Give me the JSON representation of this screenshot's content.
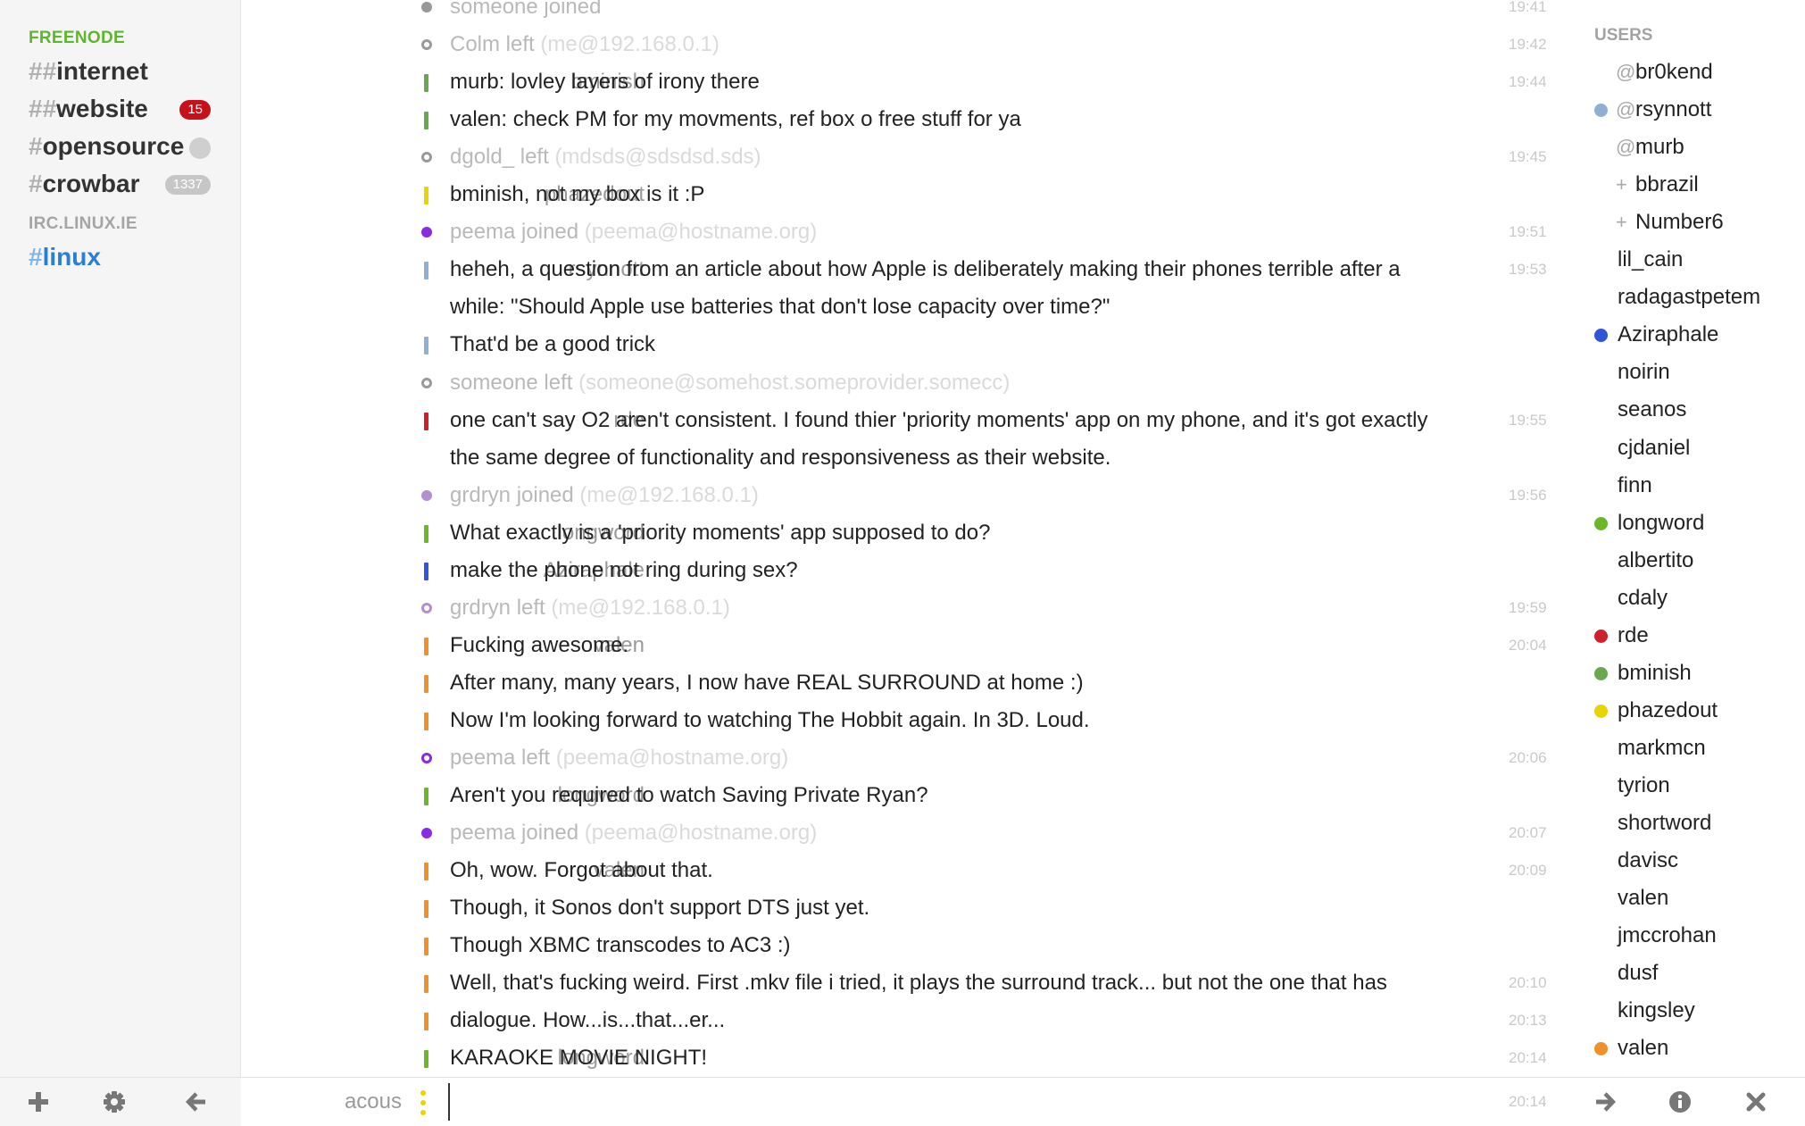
{
  "sidebar": {
    "networks": [
      {
        "name": "FREENODE",
        "color": "#5cb82a",
        "channels": [
          {
            "prefix": "##",
            "name": "internet",
            "badge": "",
            "badge_type": "none",
            "active": false
          },
          {
            "prefix": "##",
            "name": "website",
            "badge": "15",
            "badge_type": "red",
            "active": false
          },
          {
            "prefix": "#",
            "name": "opensource",
            "badge": "",
            "badge_type": "dot",
            "active": false
          },
          {
            "prefix": "#",
            "name": "crowbar",
            "badge": "1337",
            "badge_type": "gray",
            "active": false
          }
        ]
      },
      {
        "name": "IRC.LINUX.IE",
        "color": "#a5a5a5",
        "channels": [
          {
            "prefix": "#",
            "name": "linux",
            "badge": "",
            "badge_type": "none",
            "active": true
          }
        ]
      }
    ]
  },
  "messages": [
    {
      "type": "event",
      "text": "someone joined",
      "host": "",
      "time": "19:41",
      "color": "#999999",
      "event": "join"
    },
    {
      "type": "event",
      "text": "Colm left",
      "host": "(me@192.168.0.1)",
      "time": "19:42",
      "color": "#9a9a9a",
      "event": "leave"
    },
    {
      "type": "msg",
      "nick": "bminish",
      "text": "murb: lovley layers of irony there",
      "time": "19:44",
      "color": "#6aa84f"
    },
    {
      "type": "msg",
      "nick": "",
      "text": "valen: check PM for my movments, ref box o free stuff for ya",
      "time": "",
      "color": "#6aa84f"
    },
    {
      "type": "event",
      "text": "dgold_ left",
      "host": "(mdsds@sdsdsd.sds)",
      "time": "19:45",
      "color": "#9a9a9a",
      "event": "leave"
    },
    {
      "type": "msg",
      "nick": "phazedout",
      "text": "bminish, not my box is it :P",
      "time": "",
      "color": "#e8d400"
    },
    {
      "type": "event",
      "text": "peema joined",
      "host": "(peema@hostname.org)",
      "time": "19:51",
      "color": "#8a2be2",
      "event": "join"
    },
    {
      "type": "msg",
      "nick": "rsynnott",
      "text": "heheh, a question from an article about how Apple is deliberately making their phones terrible after a",
      "time": "19:53",
      "color": "#8fb0d0"
    },
    {
      "type": "msg",
      "nick": "",
      "text": "while: \"Should Apple use batteries that don't lose capacity over time?\"",
      "time": "",
      "color": "",
      "nomark": true
    },
    {
      "type": "msg",
      "nick": "",
      "text": "That'd be a good trick",
      "time": "",
      "color": "#8fb0d0"
    },
    {
      "type": "event",
      "text": "someone left",
      "host": "(someone@somehost.someprovider.somecc)",
      "time": "",
      "color": "#9a9a9a",
      "event": "leave"
    },
    {
      "type": "msg",
      "nick": "rde",
      "text": "one can't say O2 aren't consistent. I found thier 'priority moments' app on my phone, and it's got exactly",
      "time": "19:55",
      "color": "#d0212b"
    },
    {
      "type": "msg",
      "nick": "",
      "text": "the same degree of functionality and responsiveness as their website.",
      "time": "",
      "color": "",
      "nomark": true
    },
    {
      "type": "event",
      "text": "grdryn joined",
      "host": "(me@192.168.0.1)",
      "time": "19:56",
      "color": "#b38fcf",
      "event": "join"
    },
    {
      "type": "msg",
      "nick": "longword",
      "text": "What exactly is a 'priority moments' app supposed to do?",
      "time": "",
      "color": "#6ab82a"
    },
    {
      "type": "msg",
      "nick": "Aziraphale",
      "text": "make the phone not ring during sex?",
      "time": "",
      "color": "#2f56d8"
    },
    {
      "type": "event",
      "text": "grdryn left",
      "host": "(me@192.168.0.1)",
      "time": "19:59",
      "color": "#b38fcf",
      "event": "leave"
    },
    {
      "type": "msg",
      "nick": "valen",
      "text": "Fucking awesome.",
      "time": "20:04",
      "color": "#f0902a"
    },
    {
      "type": "msg",
      "nick": "",
      "text": "After many, many years, I now have REAL SURROUND at home :)",
      "time": "",
      "color": "#f0902a"
    },
    {
      "type": "msg",
      "nick": "",
      "text": "Now I'm looking forward to watching The Hobbit again. In 3D. Loud.",
      "time": "",
      "color": "#f0902a"
    },
    {
      "type": "event",
      "text": "peema left",
      "host": "(peema@hostname.org)",
      "time": "20:06",
      "color": "#8a2be2",
      "event": "leave"
    },
    {
      "type": "msg",
      "nick": "longword",
      "text": "Aren't you required to watch Saving Private Ryan?",
      "time": "",
      "color": "#6ab82a"
    },
    {
      "type": "event",
      "text": "peema joined",
      "host": "(peema@hostname.org)",
      "time": "20:07",
      "color": "#8a2be2",
      "event": "join"
    },
    {
      "type": "msg",
      "nick": "valen",
      "text": "Oh, wow. Forgot about that.",
      "time": "20:09",
      "color": "#f0902a"
    },
    {
      "type": "msg",
      "nick": "",
      "text": "Though, it Sonos don't support DTS just yet.",
      "time": "",
      "color": "#f0902a"
    },
    {
      "type": "msg",
      "nick": "",
      "text": "Though XBMC transcodes to AC3 :)",
      "time": "",
      "color": "#f0902a"
    },
    {
      "type": "msg",
      "nick": "",
      "text": "Well, that's fucking weird. First .mkv file i tried, it plays the surround track... but not the one that has",
      "time": "20:10",
      "color": "#f0902a"
    },
    {
      "type": "msg",
      "nick": "",
      "text": "dialogue. How...is...that...er...",
      "time": "20:13",
      "color": "#f0902a"
    },
    {
      "type": "msg",
      "nick": "longword",
      "text": "KARAOKE MOVIE NIGHT!",
      "time": "20:14",
      "color": "#6ab82a"
    }
  ],
  "users": {
    "title": "USERS",
    "list": [
      {
        "prefix": "@",
        "name": "br0kend",
        "dot": ""
      },
      {
        "prefix": "@",
        "name": "rsynnott",
        "dot": "#8fb0d0"
      },
      {
        "prefix": "@",
        "name": "murb",
        "dot": ""
      },
      {
        "prefix": "+",
        "name": "bbrazil",
        "dot": ""
      },
      {
        "prefix": "+",
        "name": "Number6",
        "dot": ""
      },
      {
        "prefix": "",
        "name": "lil_cain",
        "dot": ""
      },
      {
        "prefix": "",
        "name": "radagastpetem",
        "dot": ""
      },
      {
        "prefix": "",
        "name": "Aziraphale",
        "dot": "#2f56d8"
      },
      {
        "prefix": "",
        "name": "noirin",
        "dot": ""
      },
      {
        "prefix": "",
        "name": "seanos",
        "dot": ""
      },
      {
        "prefix": "",
        "name": "cjdaniel",
        "dot": ""
      },
      {
        "prefix": "",
        "name": "finn",
        "dot": ""
      },
      {
        "prefix": "",
        "name": "longword",
        "dot": "#6ab82a"
      },
      {
        "prefix": "",
        "name": "albertito",
        "dot": ""
      },
      {
        "prefix": "",
        "name": "cdaly",
        "dot": ""
      },
      {
        "prefix": "",
        "name": "rde",
        "dot": "#d0212b"
      },
      {
        "prefix": "",
        "name": "bminish",
        "dot": "#6aa84f"
      },
      {
        "prefix": "",
        "name": "phazedout",
        "dot": "#e8d400"
      },
      {
        "prefix": "",
        "name": "markmcn",
        "dot": ""
      },
      {
        "prefix": "",
        "name": "tyrion",
        "dot": ""
      },
      {
        "prefix": "",
        "name": "shortword",
        "dot": ""
      },
      {
        "prefix": "",
        "name": "davisc",
        "dot": ""
      },
      {
        "prefix": "",
        "name": "valen",
        "dot": ""
      },
      {
        "prefix": "",
        "name": "jmccrohan",
        "dot": ""
      },
      {
        "prefix": "",
        "name": "dusf",
        "dot": ""
      },
      {
        "prefix": "",
        "name": "kingsley",
        "dot": ""
      },
      {
        "prefix": "",
        "name": "valen",
        "dot": "#f0902a"
      }
    ]
  },
  "input": {
    "nick": "acous",
    "nick_color": "#e8d400",
    "value": "",
    "placeholder": "",
    "time": "20:14"
  },
  "toolbar": {
    "left": [
      {
        "name": "add-icon"
      },
      {
        "name": "gear-icon"
      },
      {
        "name": "arrow-left-icon"
      }
    ],
    "right": [
      {
        "name": "arrow-right-icon"
      },
      {
        "name": "info-icon"
      },
      {
        "name": "close-icon"
      }
    ]
  }
}
